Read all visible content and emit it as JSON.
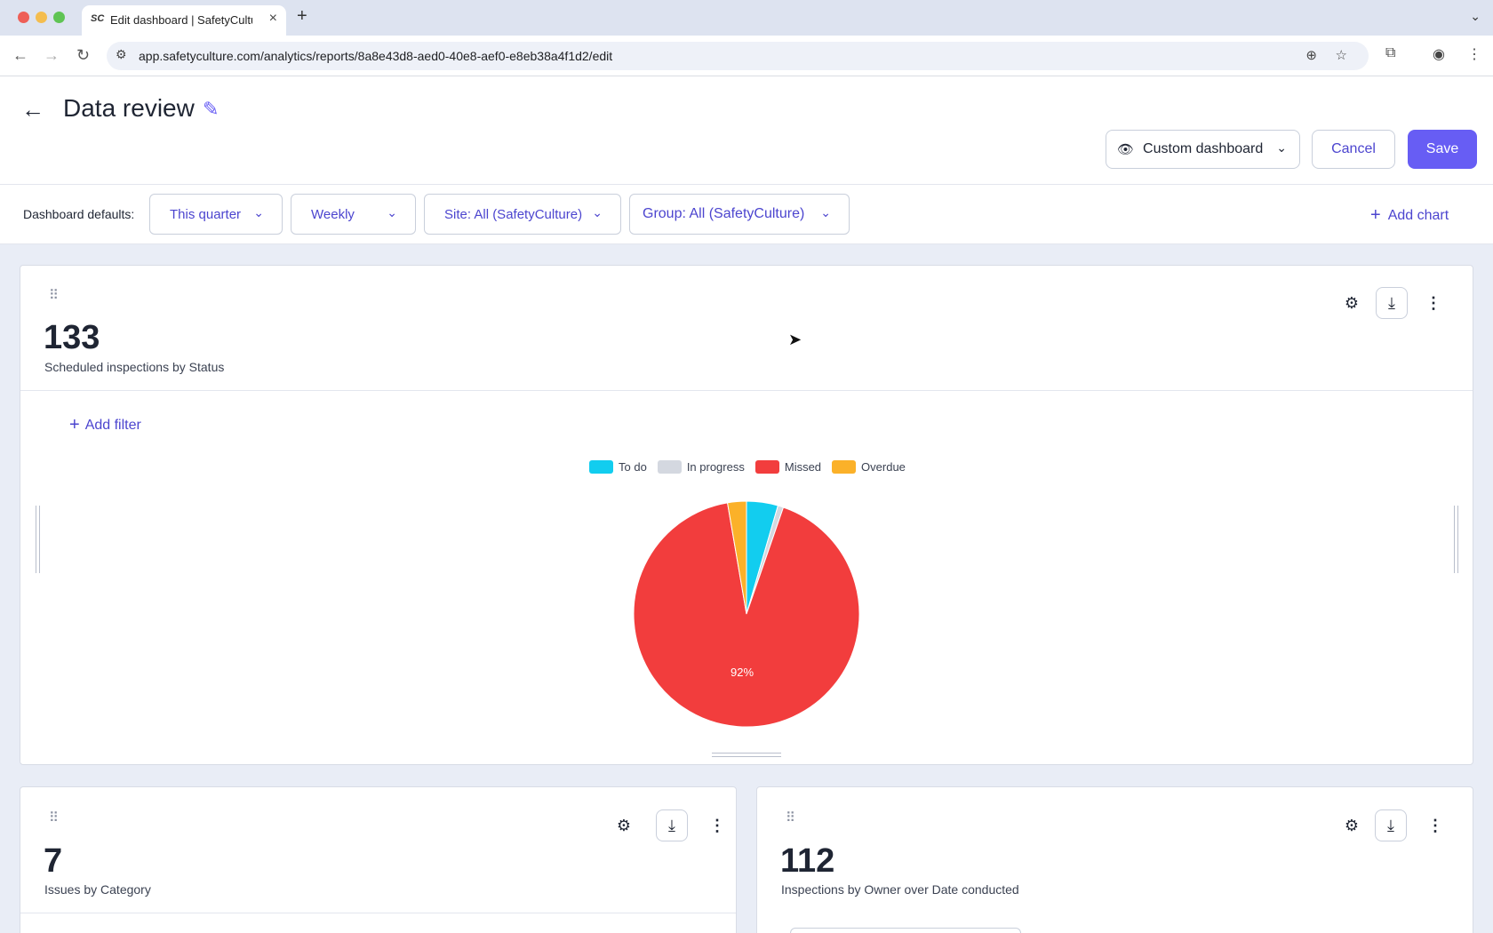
{
  "browser": {
    "tab_title": "Edit dashboard | SafetyCultur",
    "tab_favicon": "SC",
    "url": "app.safetyculture.com/analytics/reports/8a8e43d8-aed0-40e8-aef0-e8eb38a4f1d2/edit"
  },
  "header": {
    "title": "Data review",
    "view_select": "Custom dashboard",
    "cancel_label": "Cancel",
    "save_label": "Save"
  },
  "defaults": {
    "label": "Dashboard defaults:",
    "date_range": "This quarter",
    "interval": "Weekly",
    "site": "Site: All (SafetyCulture)",
    "group": "Group: All (SafetyCulture)",
    "add_chart_label": "Add chart"
  },
  "cards": {
    "main": {
      "kpi": "133",
      "label": "Scheduled inspections by Status",
      "add_filter_label": "Add filter"
    },
    "left": {
      "kpi": "7",
      "label": "Issues by Category"
    },
    "right": {
      "kpi": "112",
      "label": "Inspections by Owner over Date conducted"
    }
  },
  "chart_data": {
    "type": "pie",
    "series": [
      {
        "name": "To do",
        "value": 4.5,
        "color": "#12cdef"
      },
      {
        "name": "In progress",
        "value": 0.8,
        "color": "#d4d8e0"
      },
      {
        "name": "Missed",
        "value": 92,
        "color": "#f23d3d"
      },
      {
        "name": "Overdue",
        "value": 2.7,
        "color": "#fbb129"
      }
    ],
    "data_labels": [
      "92%"
    ],
    "legend_position": "top"
  },
  "icons": {
    "settings": "gear-icon",
    "download": "download-icon",
    "more": "more-vertical-icon",
    "drag": "drag-handle-icon"
  }
}
